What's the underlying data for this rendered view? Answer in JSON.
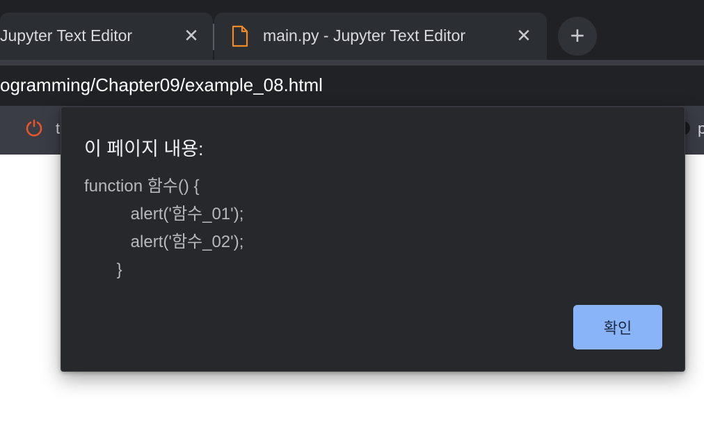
{
  "tabs": [
    {
      "title": "Jupyter Text Editor",
      "icon": "close-icon"
    },
    {
      "title": "main.py - Jupyter Text Editor",
      "icon": "file-icon",
      "icon_color": "#f08a24"
    }
  ],
  "new_tab_icon": "plus-icon",
  "address_bar": {
    "url": "ogramming/Chapter09/example_08.html"
  },
  "bookmarks": [
    {
      "label": "t",
      "icon": "refresh-circle-icon",
      "icon_color": "#e8552f"
    },
    {
      "label": "p"
    }
  ],
  "dialog": {
    "title": "이 페이지 내용:",
    "message": "function 함수() {\n          alert('함수_01');\n          alert('함수_02');\n       }",
    "ok_label": "확인",
    "button_color": "#8ab4f8"
  },
  "colors": {
    "tabstrip_bg": "#1f2125",
    "dialog_bg": "#27282c",
    "toolbar_bg": "#3a3d44"
  }
}
